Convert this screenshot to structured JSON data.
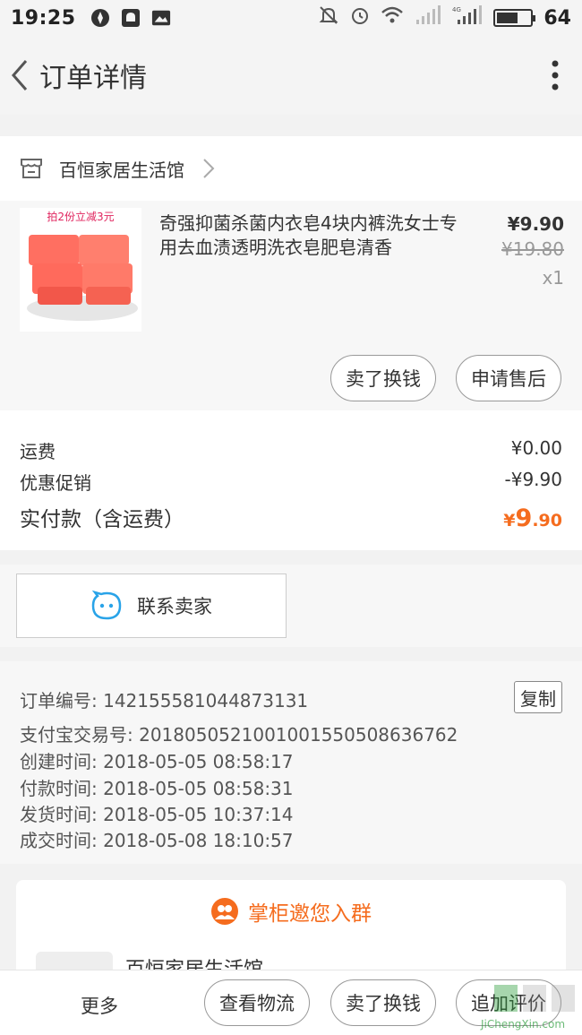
{
  "status": {
    "time": "19:25",
    "battery": "64",
    "battery_level": 0.64,
    "network": "4G"
  },
  "nav": {
    "title": "订单详情"
  },
  "shop": {
    "name": "百恒家居生活馆"
  },
  "product": {
    "image_text": "拍2份立减3元",
    "title": "奇强抑菌杀菌内衣皂4块内裤洗女士专用去血渍透明洗衣皂肥皂清香",
    "price": "¥9.90",
    "original_price": "¥19.80",
    "quantity": "x1",
    "btn_resell": "卖了换钱",
    "btn_aftersale": "申请售后"
  },
  "fees": [
    {
      "label": "运费",
      "value": "¥0.00"
    },
    {
      "label": "优惠促销",
      "value": "-¥9.90"
    }
  ],
  "total": {
    "label": "实付款（含运费）",
    "currency": "¥",
    "int": "9",
    "dec": ".90"
  },
  "contact": {
    "label": "联系卖家"
  },
  "order_info": {
    "copy_label": "复制",
    "lines": [
      "订单编号: 142155581044873131",
      "支付宝交易号: 2018050521001001550508636762",
      "创建时间: 2018-05-05 08:58:17",
      "付款时间: 2018-05-05 08:58:31",
      "发货时间: 2018-05-05 10:37:14",
      "成交时间: 2018-05-08 18:10:57"
    ]
  },
  "group": {
    "title": "掌柜邀您入群",
    "shop_name": "百恒家居生活馆"
  },
  "bottom": {
    "more": "更多",
    "logistics": "查看物流",
    "resell": "卖了换钱",
    "review": "追加评价"
  },
  "watermark": {
    "text": "JiChengXin.com"
  },
  "colors": {
    "accent": "#f56c1e",
    "contact_icon": "#29a3e8"
  }
}
